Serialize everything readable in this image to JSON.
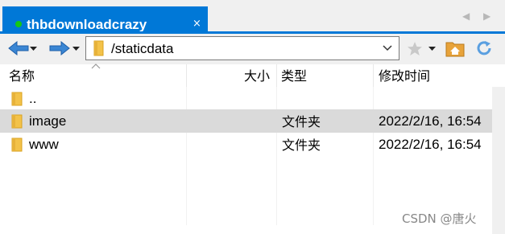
{
  "tab": {
    "title": "thbdownloadcrazy",
    "close_glyph": "×",
    "status_color": "#14c814"
  },
  "tab_nav": {
    "prev": "◀",
    "next": "▶"
  },
  "toolbar": {
    "back_icon": "arrow-left-icon",
    "forward_icon": "arrow-right-icon",
    "path": "/staticdata",
    "favorite_icon": "star-icon",
    "home_icon": "home-folder-icon",
    "refresh_icon": "refresh-icon"
  },
  "columns": {
    "name": "名称",
    "size": "大小",
    "type": "类型",
    "modified": "修改时间",
    "sort": "ascending"
  },
  "rows": [
    {
      "name": "..",
      "size": "",
      "type": "",
      "modified": "",
      "selected": false
    },
    {
      "name": "image",
      "size": "",
      "type": "文件夹",
      "modified": "2022/2/16, 16:54",
      "selected": true
    },
    {
      "name": "www",
      "size": "",
      "type": "文件夹",
      "modified": "2022/2/16, 16:54",
      "selected": false
    }
  ],
  "watermark": "CSDN @唐火",
  "colors": {
    "accent": "#0078d7",
    "selection": "#dadada",
    "folder": "#f3c249"
  }
}
